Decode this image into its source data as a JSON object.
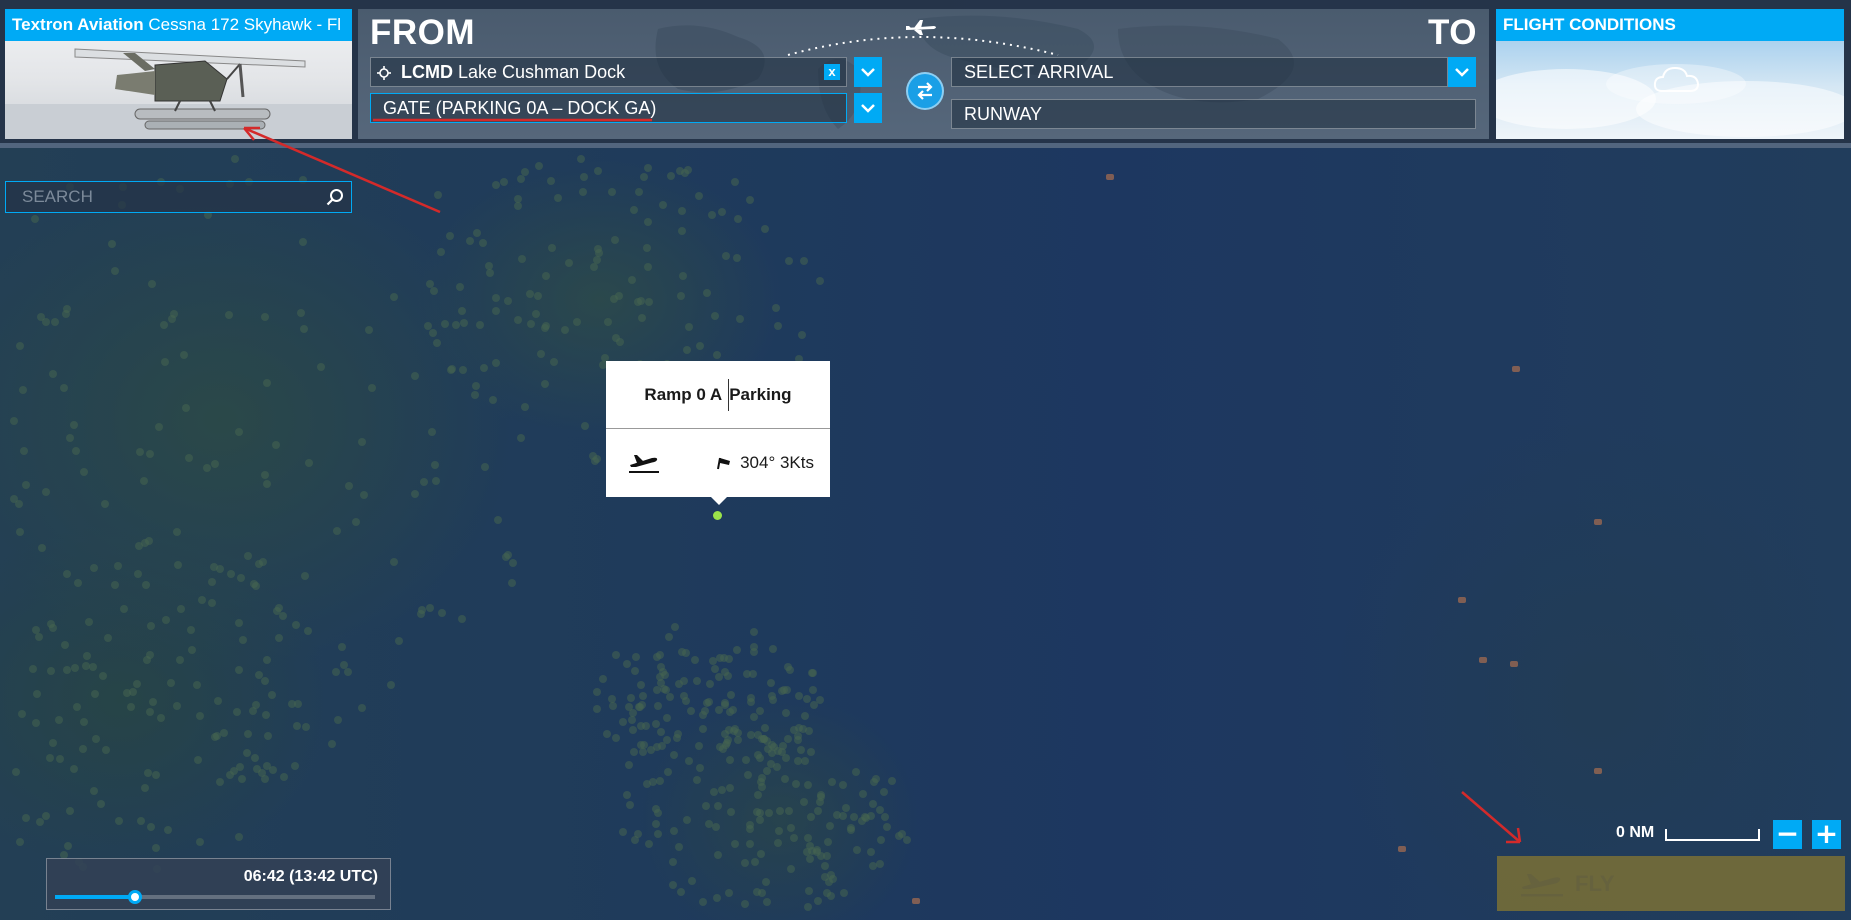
{
  "aircraft": {
    "brand": "Textron Aviation",
    "model": "Cessna 172 Skyhawk - Fl"
  },
  "route": {
    "from_label": "FROM",
    "to_label": "TO",
    "departure_icao": "LCMD",
    "departure_name": "Lake Cushman Dock",
    "clear_label": "x",
    "departure_spot": "GATE (PARKING 0A – DOCK GA)",
    "arrival": "SELECT ARRIVAL",
    "arrival_spot": "RUNWAY"
  },
  "conditions": {
    "title": "FLIGHT CONDITIONS"
  },
  "search": {
    "placeholder": "SEARCH"
  },
  "popup": {
    "name": "Ramp 0 A",
    "type": "Parking",
    "wind": "304° 3Kts"
  },
  "time": {
    "display": "06:42 (13:42 UTC)",
    "slider_fraction": 0.25
  },
  "scale": {
    "label": "0 NM"
  },
  "zoom": {
    "out_label": "−",
    "in_label": "+"
  },
  "fly": {
    "label": "FLY"
  },
  "colors": {
    "accent": "#00aaf5",
    "fly_bg": "#786e37",
    "annotation": "#d42a2a"
  }
}
